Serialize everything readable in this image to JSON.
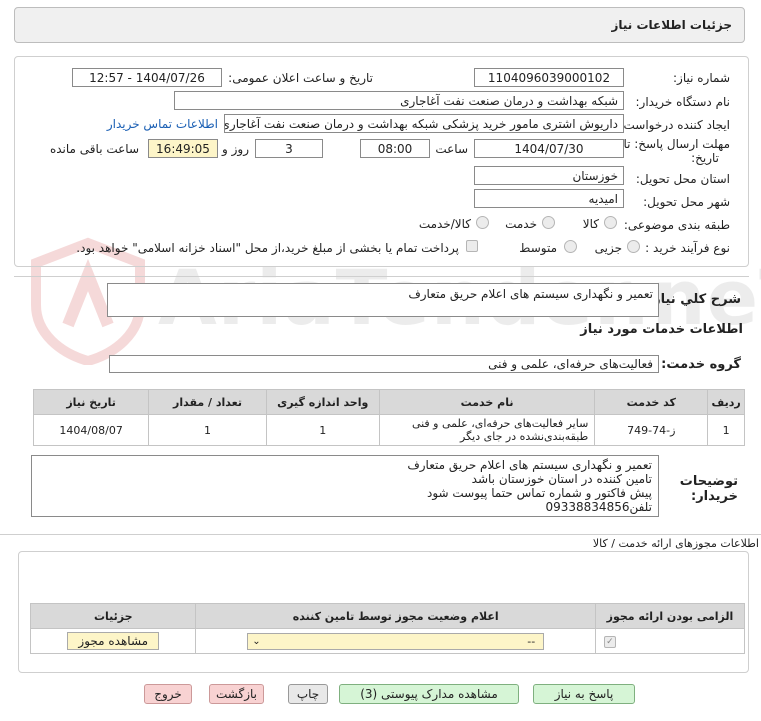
{
  "header": {
    "title": "جزئیات اطلاعات نیاز"
  },
  "form": {
    "need_number_label": "شماره نیاز:",
    "need_number": "1104096039000102",
    "announce_label": "تاریخ و ساعت اعلان عمومی:",
    "announce_value": "1404/07/26 - 12:57",
    "buyer_org_label": "نام دستگاه خریدار:",
    "buyer_org": "شبکه بهداشت و درمان صنعت نفت آغاجاری",
    "requester_label": "ایجاد کننده درخواست:",
    "requester": "داریوش اشتری مامور خرید پزشکی شبکه بهداشت و درمان صنعت نفت آغاجاری",
    "contact_link": "اطلاعات تماس خریدار",
    "deadline_label_1": "مهلت ارسال پاسخ: تا",
    "deadline_label_2": "تاریخ:",
    "deadline_date": "1404/07/30",
    "time_label": "ساعت",
    "deadline_time": "08:00",
    "days_label": "روز و",
    "days_value": "3",
    "remaining_time": "16:49:05",
    "remaining_label": "ساعت باقی مانده",
    "province_label": "استان محل تحویل:",
    "province": "خوزستان",
    "city_label": "شهر محل تحویل:",
    "city": "امیدیه",
    "category_label": "طبقه بندی موضوعی:",
    "category_options": [
      "کالا",
      "خدمت",
      "کالا/خدمت"
    ],
    "process_label": "نوع فرآیند خرید :",
    "process_options": [
      "جزیی",
      "متوسط"
    ],
    "payment_note": "پرداخت تمام یا بخشی از مبلغ خرید،از محل \"اسناد خزانه اسلامی\" خواهد بود."
  },
  "summary": {
    "label": "شرح کلي نياز:",
    "text": "تعمیر و نگهداری سیستم های اعلام حریق متعارف"
  },
  "services": {
    "section_title": "اطلاعات خدمات مورد نیاز",
    "group_label": "گروه خدمت:",
    "group_value": "فعالیت‌های حرفه‌ای، علمی و فنی",
    "columns": [
      "ردیف",
      "کد خدمت",
      "نام خدمت",
      "واحد اندازه گیری",
      "تعداد / مقدار",
      "تاریخ نیاز"
    ],
    "rows": [
      {
        "row": "1",
        "code": "ز-74-749",
        "name": "سایر فعالیت‌های حرفه‌ای، علمی و فنی طبقه‌بندی‌نشده در جای دیگر",
        "unit": "1",
        "qty": "1",
        "date": "1404/08/07"
      }
    ]
  },
  "buyer_notes": {
    "label_1": "توضیحات",
    "label_2": "خریدار:",
    "lines": [
      "تعمیر و نگهداری سیستم های اعلام حریق متعارف",
      "تامین کننده در استان خوزستان باشد",
      "پیش فاکتور و شماره تماس حتما پیوست شود",
      "تلفن09338834856"
    ]
  },
  "permits": {
    "section_title": "اطلاعات مجوزهای ارائه خدمت / کالا",
    "columns": [
      "الزامی بودن ارائه مجوز",
      "اعلام وضعیت مجوز توسط تامین کننده",
      "جزئیات"
    ],
    "select_value": "--",
    "view_button": "مشاهده مجوز"
  },
  "footer": {
    "reply": "پاسخ به نیاز",
    "attachments": "مشاهده مدارک پیوستی (3)",
    "print": "چاپ",
    "back": "بازگشت",
    "exit": "خروج"
  },
  "watermark": "AriaTender.neT"
}
